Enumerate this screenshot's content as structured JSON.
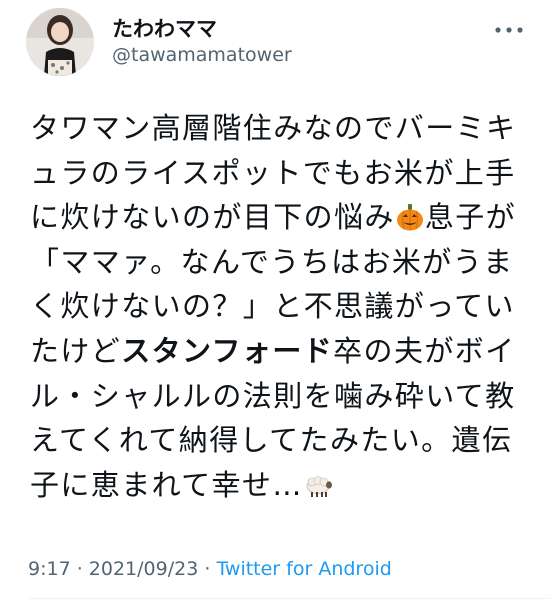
{
  "user": {
    "display_name": "たわわママ",
    "handle": "@tawamamatower",
    "avatar_icon": "user-avatar"
  },
  "tweet": {
    "lines": [
      [
        "タワマン高層階住みなのでバーミキ"
      ],
      [
        "ュラのライスポットでもお米が上手"
      ],
      [
        "に炊けないのが目下の悩み",
        "息子が"
      ],
      [
        "「ママァ。なんでうちはお米がうま"
      ],
      [
        "く炊けないの？」と不思議がってい"
      ],
      [
        "たけど",
        "スタンフォード",
        "卒の夫がボイ"
      ],
      [
        "ル・シャルルの法則を噛み砕いて教"
      ],
      [
        "えてくれて納得してたみたい。遺伝"
      ],
      [
        "子に恵まれて幸せ…"
      ]
    ],
    "emojis": [
      "jack-o-lantern-emoji",
      "sheep-emoji"
    ]
  },
  "meta": {
    "time": "9:17",
    "sep1": " · ",
    "date": "2021/09/23",
    "sep2": " · ",
    "source": "Twitter for Android"
  },
  "colors": {
    "text": "#0f1419",
    "secondary": "#536471",
    "link": "#1d9bf0"
  }
}
